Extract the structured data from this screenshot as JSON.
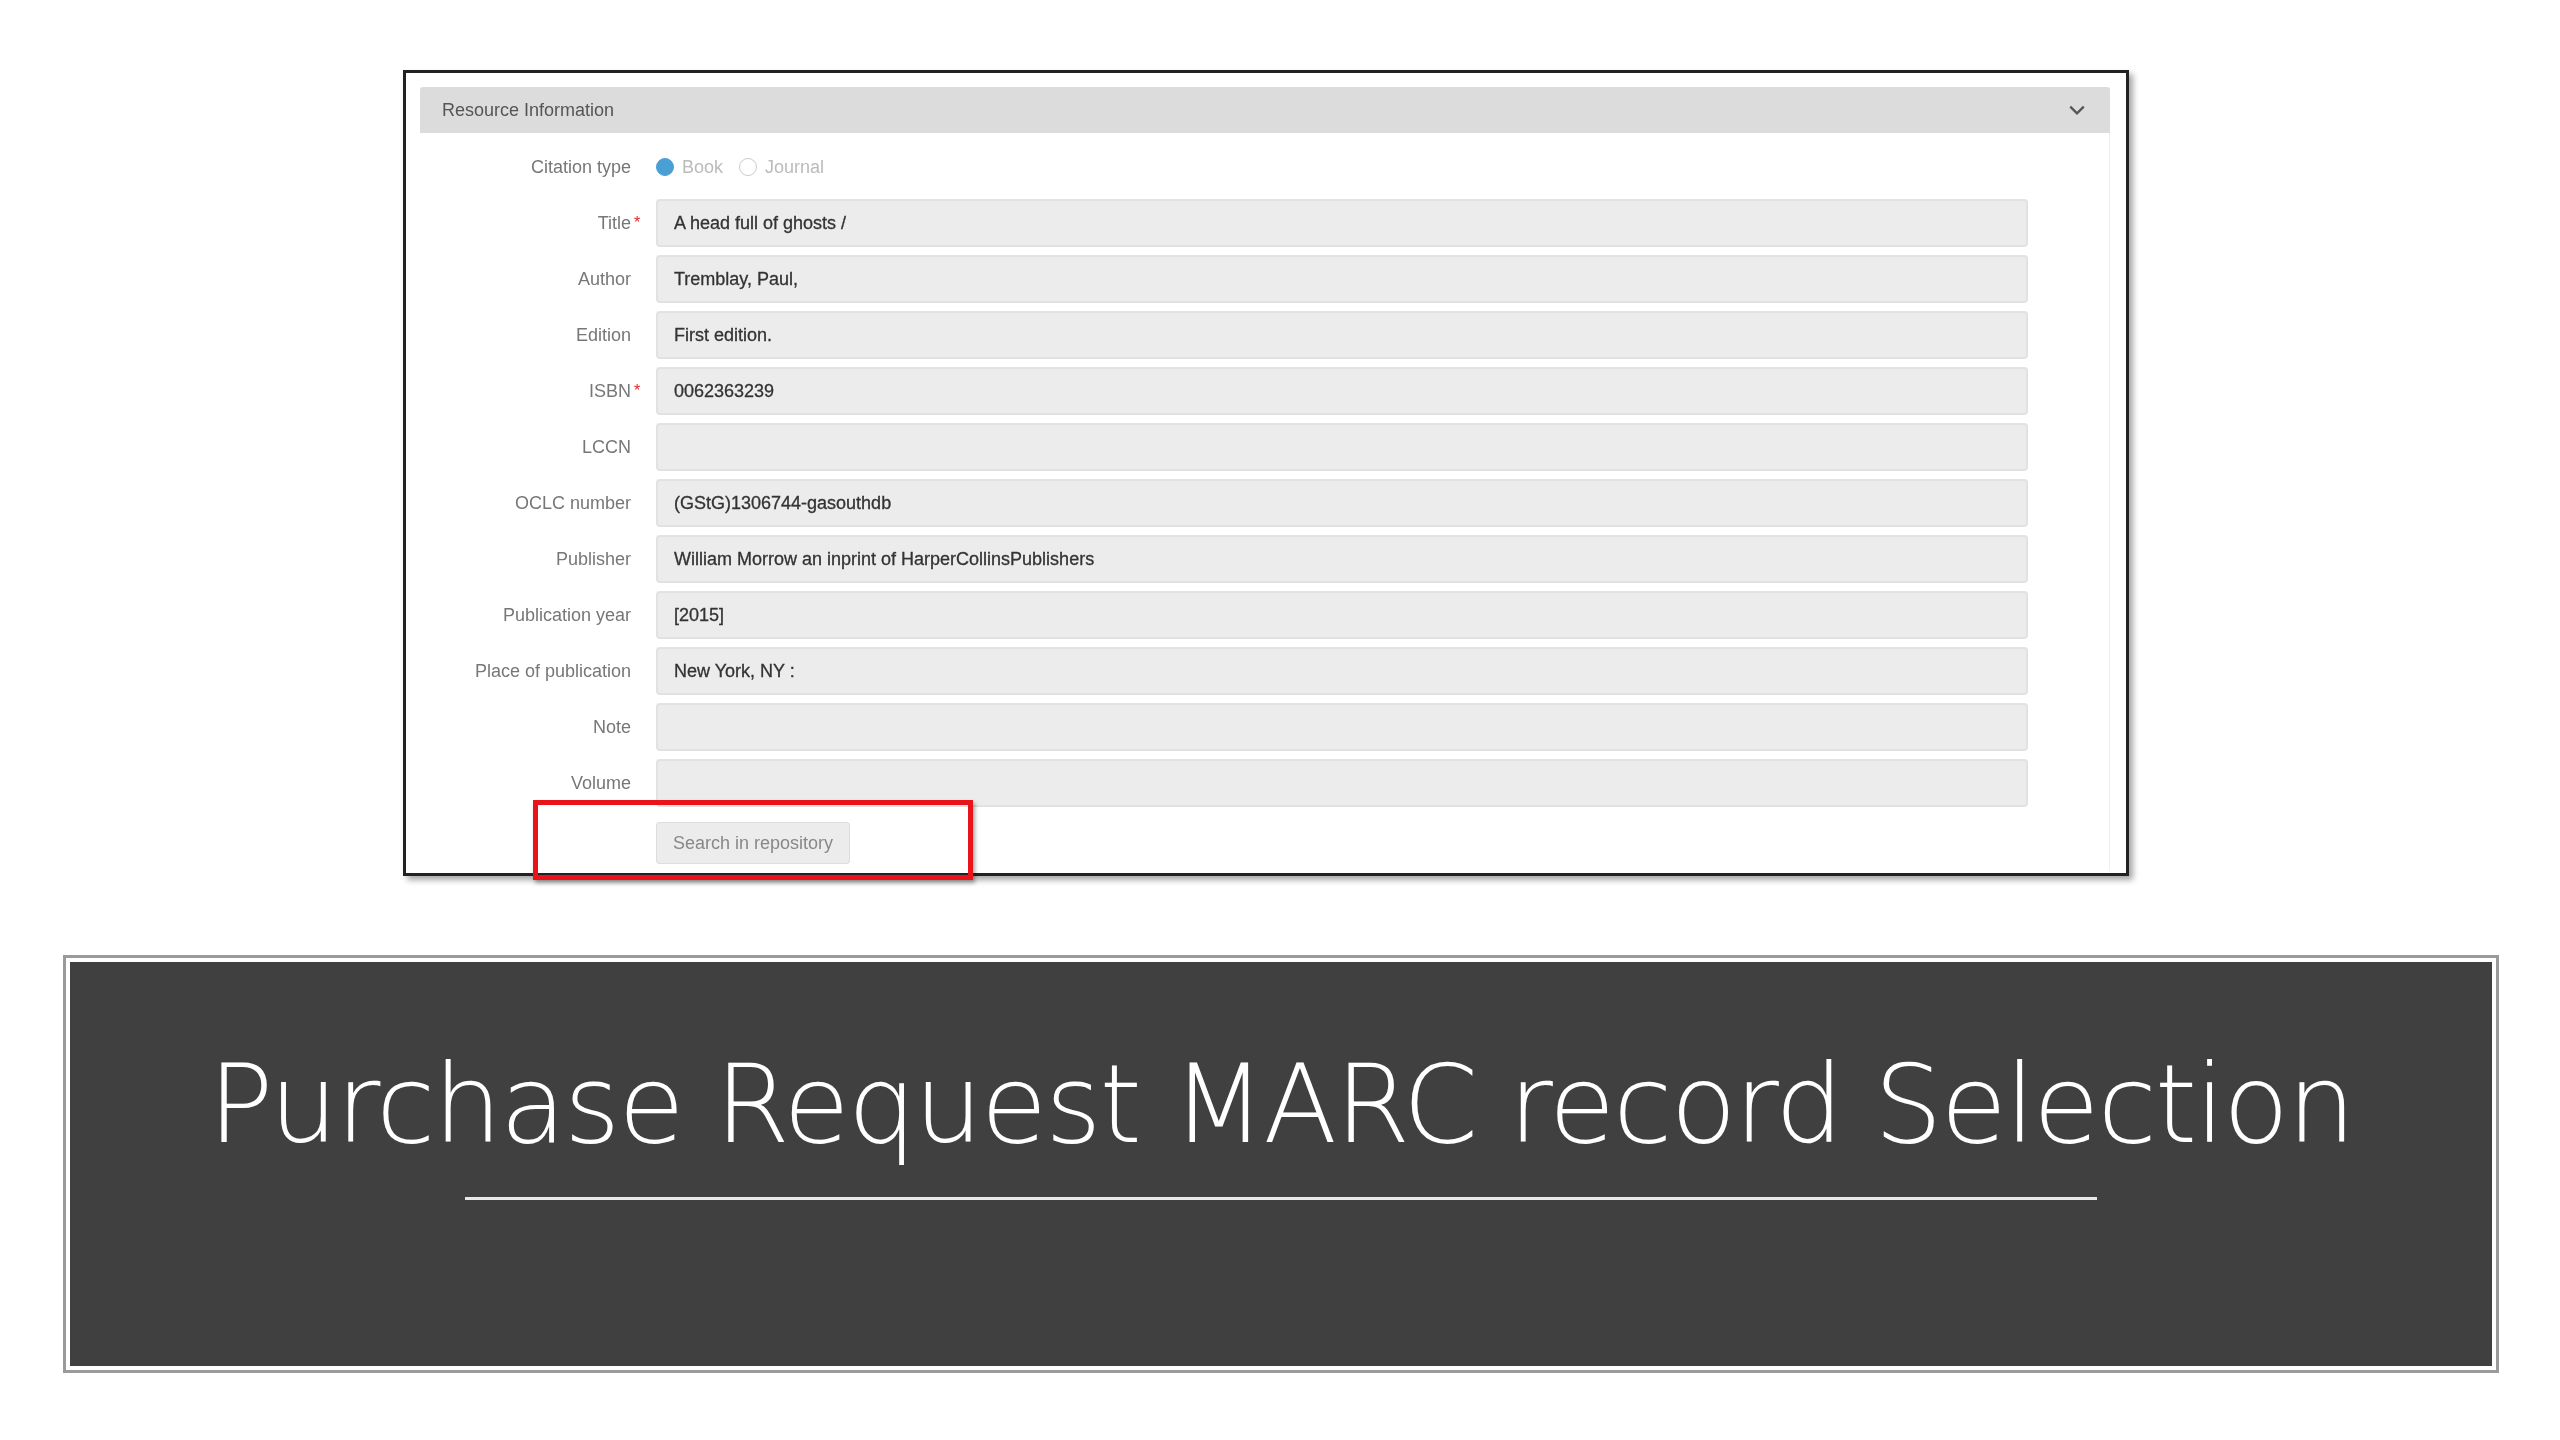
{
  "panel": {
    "title": "Resource Information",
    "expanded": true,
    "rows": [
      {
        "kind": "radio",
        "label": "Citation type",
        "options": [
          {
            "label": "Book",
            "selected": true
          },
          {
            "label": "Journal",
            "selected": false
          }
        ]
      },
      {
        "kind": "text",
        "label": "Title",
        "required_marker": "*",
        "value": "A head full of ghosts /"
      },
      {
        "kind": "text",
        "label": "Author",
        "value": "Tremblay, Paul,"
      },
      {
        "kind": "text",
        "label": "Edition",
        "value": "First edition."
      },
      {
        "kind": "text",
        "label": "ISBN",
        "required_marker": "*",
        "value": "0062363239"
      },
      {
        "kind": "text",
        "label": "LCCN"
      },
      {
        "kind": "text",
        "label": "OCLC number",
        "value": "(GStG)1306744-gasouthdb"
      },
      {
        "kind": "text",
        "label": "Publisher",
        "value": "William Morrow an inprint of HarperCollinsPublishers"
      },
      {
        "kind": "text",
        "label": "Publication year",
        "value": "[2015]"
      },
      {
        "kind": "text",
        "label": "Place of publication",
        "value": "New York, NY :"
      },
      {
        "kind": "text",
        "label": "Note"
      },
      {
        "kind": "text",
        "label": "Volume"
      }
    ],
    "button": {
      "label": "Search in repository",
      "highlighted": true
    }
  },
  "banner": {
    "title": "Purchase Request MARC record Selection"
  }
}
